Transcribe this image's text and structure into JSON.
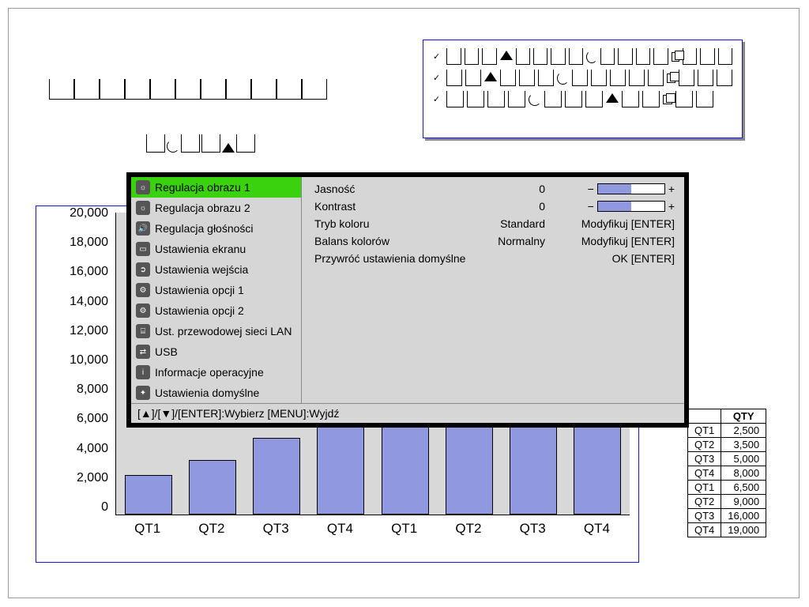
{
  "chart_data": {
    "type": "bar",
    "categories": [
      "QT1",
      "QT2",
      "QT3",
      "QT4",
      "QT1",
      "QT2",
      "QT3",
      "QT4"
    ],
    "values": [
      2500,
      3500,
      5000,
      8000,
      6500,
      9000,
      16000,
      19000
    ],
    "ylim": [
      0,
      20000
    ],
    "ylabel": "",
    "xlabel": "",
    "title": ""
  },
  "qty_table": {
    "header": "QTY",
    "rows": [
      {
        "label": "QT1",
        "value": "2,500"
      },
      {
        "label": "QT2",
        "value": "3,500"
      },
      {
        "label": "QT3",
        "value": "5,000"
      },
      {
        "label": "QT4",
        "value": "8,000"
      },
      {
        "label": "QT1",
        "value": "6,500"
      },
      {
        "label": "QT2",
        "value": "9,000"
      },
      {
        "label": "QT3",
        "value": "16,000"
      },
      {
        "label": "QT4",
        "value": "19,000"
      }
    ]
  },
  "y_ticks": [
    "20,000",
    "18,000",
    "16,000",
    "14,000",
    "12,000",
    "10,000",
    "8,000",
    "6,000",
    "4,000",
    "2,000",
    "0"
  ],
  "osd": {
    "left_items": [
      "Regulacja obrazu 1",
      "Regulacja obrazu 2",
      "Regulacja głośności",
      "Ustawienia ekranu",
      "Ustawienia wejścia",
      "Ustawienia opcji 1",
      "Ustawienia opcji 2",
      "Ust. przewodowej sieci LAN",
      "USB",
      "Informacje operacyjne",
      "Ustawienia domyślne"
    ],
    "right": {
      "brightness_label": "Jasność",
      "brightness_value": "0",
      "contrast_label": "Kontrast",
      "contrast_value": "0",
      "colormode_label": "Tryb koloru",
      "colormode_value": "Standard",
      "modify": "Modyfikuj [ENTER]",
      "balance_label": "Balans kolorów",
      "balance_value": "Normalny",
      "restore_label": "Przywróć ustawienia domyślne",
      "restore_action": "OK [ENTER]"
    },
    "footer": "[▲]/[▼]/[ENTER]:Wybierz  [MENU]:Wyjdź"
  },
  "icons": {
    "left": [
      "sun",
      "sun",
      "speaker",
      "screen",
      "input",
      "wrench",
      "wrench",
      "lan",
      "usb",
      "info",
      "sparkle"
    ]
  }
}
